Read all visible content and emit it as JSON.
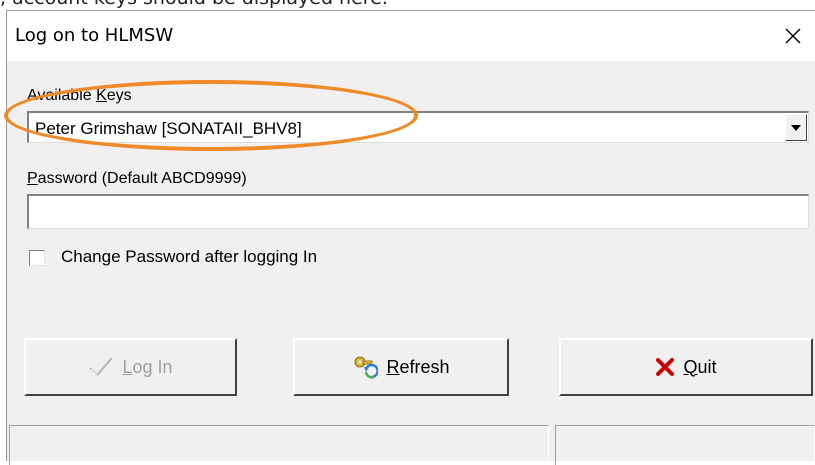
{
  "caption": ", account keys should be displayed here.",
  "window": {
    "title": "Log on to HLMSW",
    "close_icon": "close-icon"
  },
  "keys": {
    "label_prefix": "Available ",
    "label_accel": "K",
    "label_suffix": "eys",
    "selected": "Peter Grimshaw [SONATAII_BHV8]",
    "arrow_icon": "dropdown-arrow-icon"
  },
  "password": {
    "label_accel": "P",
    "label_suffix": "assword (Default ABCD9999)",
    "value": "",
    "placeholder": ""
  },
  "change_password": {
    "label": "Change Password after logging In",
    "checked": false
  },
  "buttons": {
    "login": {
      "accel": "L",
      "rest": "og In",
      "icon": "checkmark-icon",
      "enabled": false
    },
    "refresh": {
      "accel": "R",
      "rest": "efresh",
      "icon": "keys-refresh-icon",
      "enabled": true
    },
    "quit": {
      "accel": "Q",
      "rest": "uit",
      "icon": "red-x-icon",
      "enabled": true
    }
  },
  "annotation": {
    "highlight_color": "#ef8a2a"
  },
  "colors": {
    "window_bg": "#f0f0f0",
    "titlebar_bg": "#ffffff",
    "disabled_text": "#a0a0a0",
    "quit_icon": "#cc0000"
  }
}
